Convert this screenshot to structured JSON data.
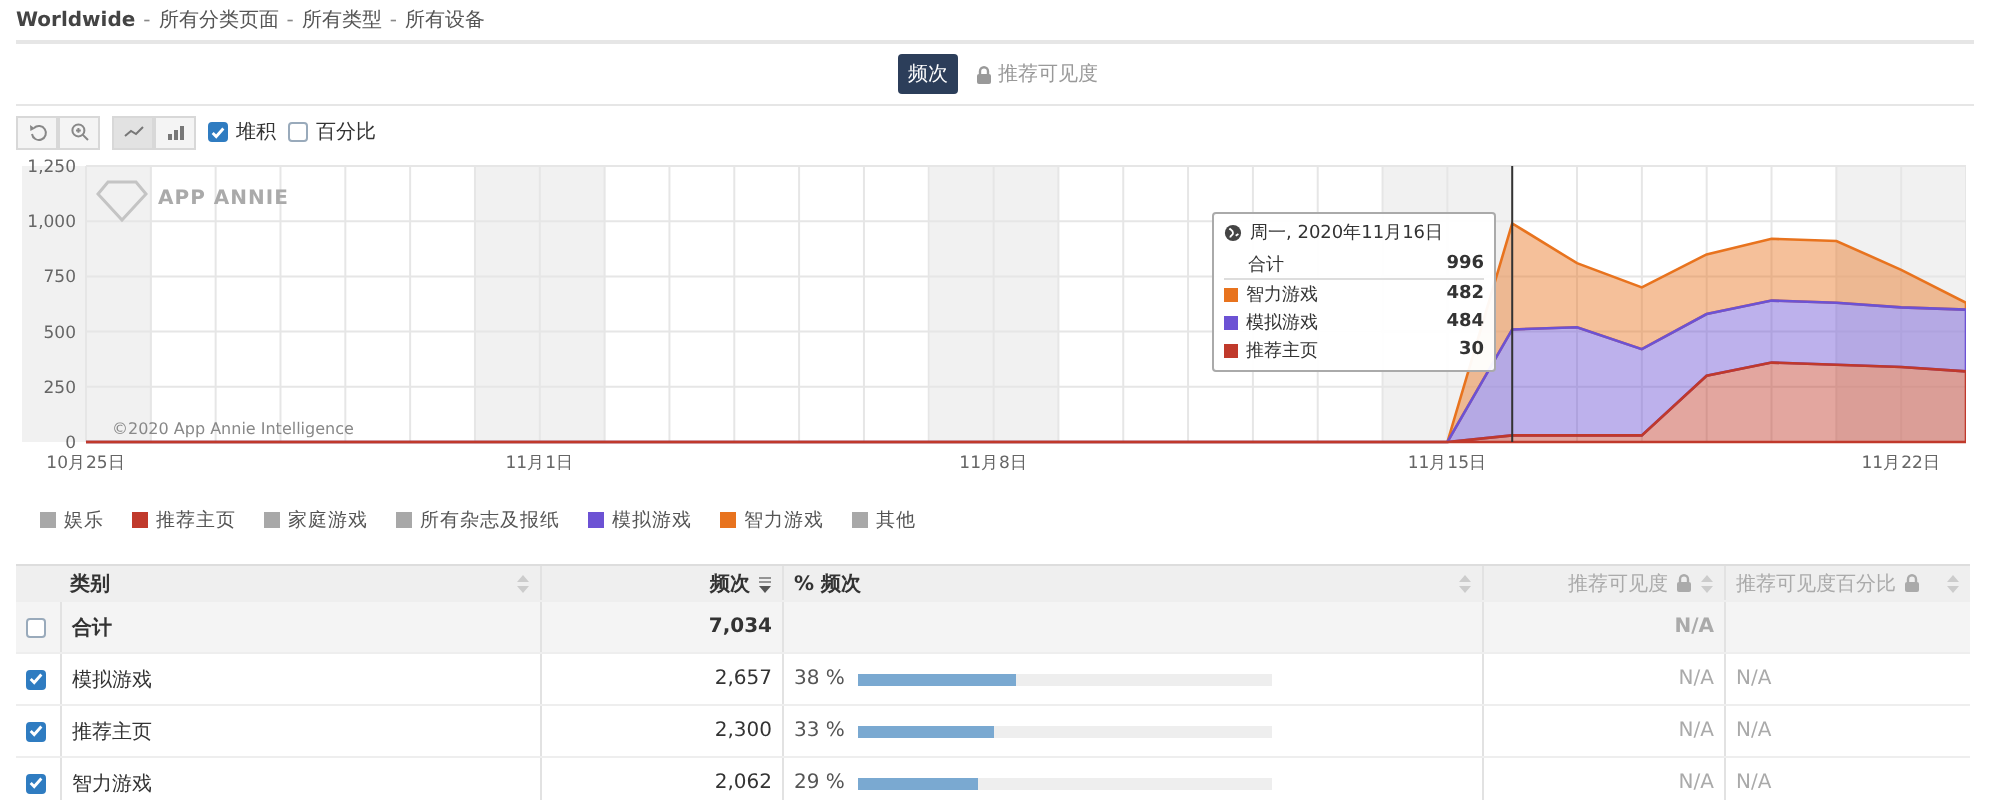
{
  "breadcrumb": [
    {
      "kind": "root",
      "text": "Worldwide"
    },
    {
      "kind": "separator",
      "text": "-"
    },
    {
      "kind": "crumb",
      "text": "所有分类页面"
    },
    {
      "kind": "separator",
      "text": "-"
    },
    {
      "kind": "crumb",
      "text": "所有类型"
    },
    {
      "kind": "separator",
      "text": "-"
    },
    {
      "kind": "crumb",
      "text": "所有设备"
    }
  ],
  "metric_tabs": [
    {
      "label": "频次",
      "selected": true,
      "locked": false
    },
    {
      "label": "推荐可见度",
      "selected": false,
      "locked": true
    }
  ],
  "toolbar": {
    "actions": [
      {
        "kind": "reset"
      },
      {
        "kind": "zoom"
      }
    ],
    "chart_types": [
      {
        "kind": "line",
        "selected": true
      },
      {
        "kind": "bar",
        "selected": false
      }
    ],
    "options": [
      {
        "label": "堆积",
        "checked": true
      },
      {
        "label": "百分比",
        "checked": false
      }
    ]
  },
  "chart": {
    "watermark": "APP ANNIE",
    "credit": "©2020 App Annie Intelligence",
    "tooltip": {
      "date": "周一, 2020年11月16日",
      "total_label": "合计",
      "total": "996",
      "values": [
        "482",
        "484",
        "30"
      ]
    },
    "chart_data": {
      "type": "area",
      "stacked": true,
      "categories": [
        "10月25日",
        null,
        null,
        null,
        null,
        null,
        null,
        "11月1日",
        null,
        null,
        null,
        null,
        null,
        null,
        "11月8日",
        null,
        null,
        null,
        null,
        null,
        null,
        "11月15日",
        null,
        null,
        null,
        null,
        null,
        null,
        "11月22日",
        null
      ],
      "ylim": [
        0,
        1250
      ],
      "yticks": [
        {
          "value": 0,
          "label": "0"
        },
        {
          "value": 250,
          "label": "250"
        },
        {
          "value": 500,
          "label": "500"
        },
        {
          "value": 750,
          "label": "750"
        },
        {
          "value": 1000,
          "label": "1,000"
        },
        {
          "value": 1250,
          "label": "1,250"
        }
      ],
      "series": [
        {
          "name": "推荐主页",
          "color": "#c0392b",
          "values": [
            0,
            0,
            0,
            0,
            0,
            0,
            0,
            0,
            0,
            0,
            0,
            0,
            0,
            0,
            0,
            0,
            0,
            0,
            0,
            0,
            0,
            0,
            30,
            30,
            30,
            300,
            360,
            350,
            340,
            320
          ]
        },
        {
          "name": "模拟游戏",
          "color": "#6c52d4",
          "values": [
            0,
            0,
            0,
            0,
            0,
            0,
            0,
            0,
            0,
            0,
            0,
            0,
            0,
            0,
            0,
            0,
            0,
            0,
            0,
            0,
            0,
            0,
            480,
            490,
            390,
            280,
            280,
            280,
            270,
            280
          ]
        },
        {
          "name": "智力游戏",
          "color": "#e8731e",
          "values": [
            0,
            0,
            0,
            0,
            0,
            0,
            0,
            0,
            0,
            0,
            0,
            0,
            0,
            0,
            0,
            0,
            0,
            0,
            0,
            0,
            0,
            0,
            480,
            290,
            280,
            270,
            280,
            280,
            170,
            30
          ]
        }
      ],
      "grid": true
    }
  },
  "legend": [
    {
      "label": "娱乐",
      "color": "#a8a8a8"
    },
    {
      "label": "推荐主页",
      "color": "#c0392b"
    },
    {
      "label": "家庭游戏",
      "color": "#a8a8a8"
    },
    {
      "label": "所有杂志及报纸",
      "color": "#a8a8a8"
    },
    {
      "label": "模拟游戏",
      "color": "#6c52d4"
    },
    {
      "label": "智力游戏",
      "color": "#e8731e"
    },
    {
      "label": "其他",
      "color": "#a8a8a8"
    }
  ],
  "table": {
    "columns": [
      {
        "label": "类别",
        "sorted": false,
        "locked": false
      },
      {
        "label": "频次",
        "sorted": true,
        "locked": false
      },
      {
        "label": "% 频次",
        "sorted": false,
        "locked": false
      },
      {
        "label": "推荐可见度",
        "sorted": false,
        "locked": true
      },
      {
        "label": "推荐可见度百分比",
        "sorted": false,
        "locked": true
      }
    ],
    "rows": [
      {
        "kind": "total",
        "checked": false,
        "category": "合计",
        "count": "7,034",
        "visibility": "N/A"
      },
      {
        "kind": "item",
        "checked": true,
        "category": "模拟游戏",
        "count": "2,657",
        "percent": "38 %",
        "level": 0.38,
        "visibility": "N/A",
        "visibility_percent": "N/A"
      },
      {
        "kind": "item",
        "checked": true,
        "category": "推荐主页",
        "count": "2,300",
        "percent": "33 %",
        "level": 0.33,
        "visibility": "N/A",
        "visibility_percent": "N/A"
      },
      {
        "kind": "item",
        "checked": true,
        "category": "智力游戏",
        "count": "2,062",
        "percent": "29 %",
        "level": 0.29,
        "visibility": "N/A",
        "visibility_percent": "N/A"
      }
    ]
  }
}
